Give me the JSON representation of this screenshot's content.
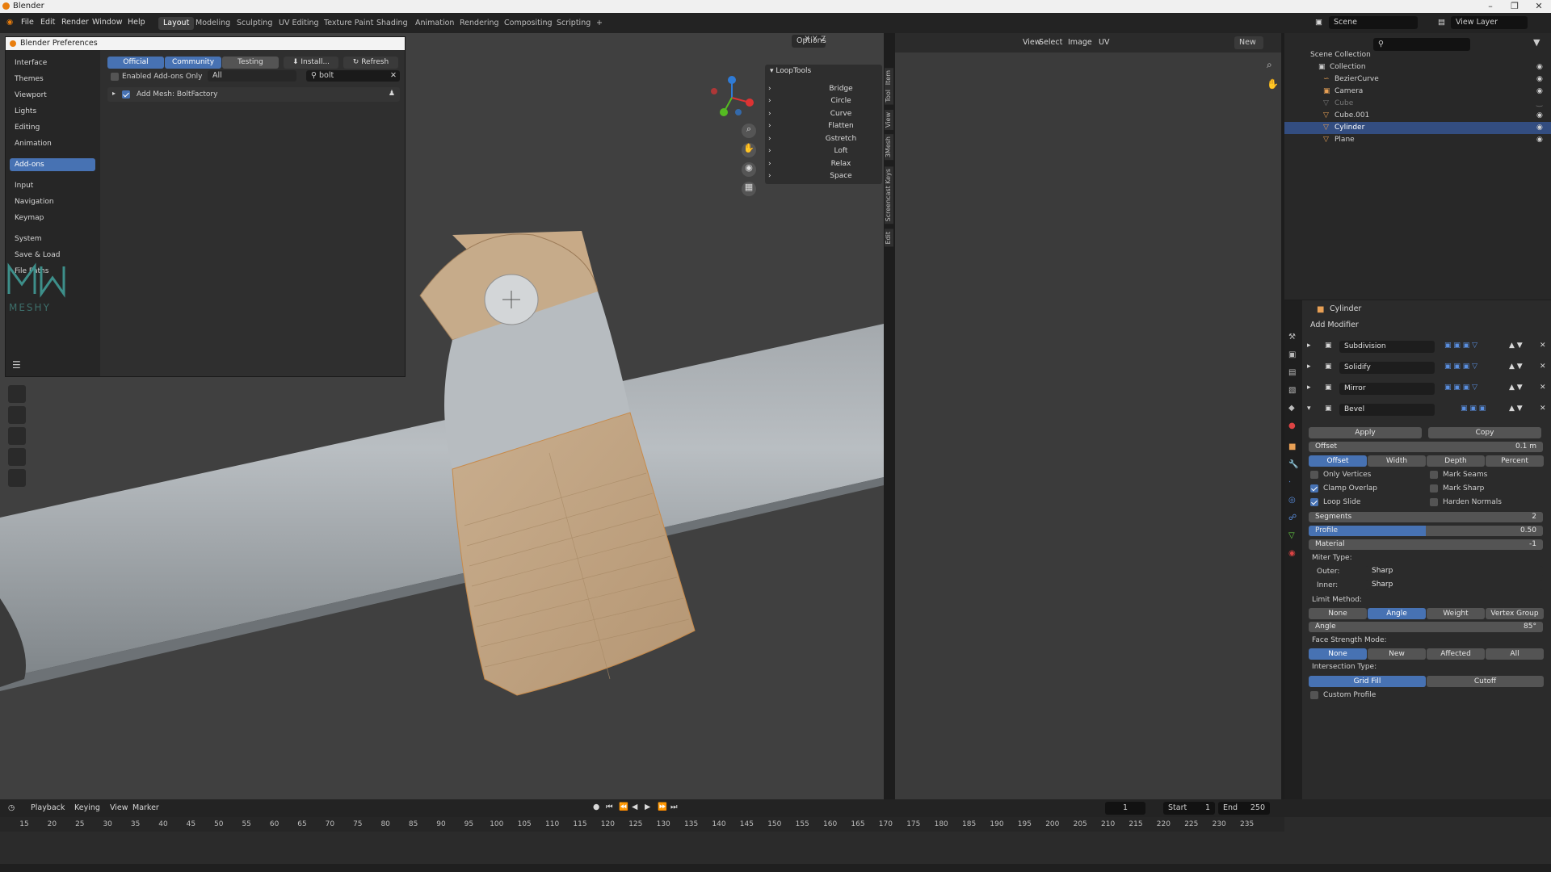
{
  "window": {
    "title": "Blender"
  },
  "menu": {
    "items": [
      "File",
      "Edit",
      "Render",
      "Window",
      "Help"
    ]
  },
  "workspaces": [
    "Layout",
    "Modeling",
    "Sculpting",
    "UV Editing",
    "Texture Paint",
    "Shading",
    "Animation",
    "Rendering",
    "Compositing",
    "Scripting"
  ],
  "workspace_add": "+",
  "scene": {
    "label": "Scene",
    "view_layer": "View Layer"
  },
  "viewport": {
    "options_label": "Options",
    "axes": [
      "X",
      "Y",
      "Z"
    ]
  },
  "image_editor": {
    "menu": [
      "View",
      "Select",
      "Image",
      "UV"
    ],
    "new_label": "New"
  },
  "preferences": {
    "title": "Blender Preferences",
    "sidebar": [
      "Interface",
      "Themes",
      "Viewport",
      "Lights",
      "Editing",
      "Animation",
      "Add-ons",
      "Input",
      "Navigation",
      "Keymap",
      "System",
      "Save & Load",
      "File Paths"
    ],
    "active": "Add-ons",
    "tabs": [
      "Official",
      "Community",
      "Testing"
    ],
    "install_label": "Install...",
    "refresh_label": "Refresh",
    "enabled_only_label": "Enabled Add-ons Only",
    "category": "All",
    "search_value": "bolt",
    "addon": "Add Mesh: BoltFactory",
    "watermark": "MESHY"
  },
  "looptools": {
    "title": "LoopTools",
    "items": [
      "Bridge",
      "Circle",
      "Curve",
      "Flatten",
      "Gstretch",
      "Loft",
      "Relax",
      "Space"
    ]
  },
  "side_tabs": [
    "Item",
    "Tool",
    "View",
    "3Mesh",
    "Screencast Keys",
    "Edit"
  ],
  "outliner": {
    "root": "Scene Collection",
    "collection": "Collection",
    "objects": [
      "BezierCurve",
      "Camera",
      "Cube",
      "Cube.001",
      "Cylinder",
      "Plane"
    ],
    "selected": "Cylinder"
  },
  "properties": {
    "object": "Cylinder",
    "add_modifier": "Add Modifier",
    "modifiers": [
      "Subdivision",
      "Solidify",
      "Mirror",
      "Bevel"
    ],
    "apply_label": "Apply",
    "copy_label": "Copy",
    "offset_label": "Offset",
    "offset_value": "0.1 m",
    "width_types": [
      "Offset",
      "Width",
      "Depth",
      "Percent"
    ],
    "only_vertices": "Only Vertices",
    "clamp_overlap": "Clamp Overlap",
    "loop_slide": "Loop Slide",
    "mark_seams": "Mark Seams",
    "mark_sharp": "Mark Sharp",
    "harden_normals": "Harden Normals",
    "segments_label": "Segments",
    "segments_value": "2",
    "profile_label": "Profile",
    "profile_value": "0.50",
    "profile_fraction": 0.5,
    "material_label": "Material",
    "material_value": "-1",
    "miter_type": "Miter Type:",
    "outer_label": "Outer:",
    "outer_value": "Sharp",
    "inner_label": "Inner:",
    "inner_value": "Sharp",
    "limit_method": "Limit Method:",
    "limit_options": [
      "None",
      "Angle",
      "Weight",
      "Vertex Group"
    ],
    "angle_label": "Angle",
    "angle_value": "85°",
    "face_strength": "Face Strength Mode:",
    "face_options": [
      "None",
      "New",
      "Affected",
      "All"
    ],
    "intersection": "Intersection Type:",
    "intersection_options": [
      "Grid Fill",
      "Cutoff"
    ],
    "custom_profile": "Custom Profile"
  },
  "timeline": {
    "menu": [
      "Playback",
      "Keying",
      "View",
      "Marker"
    ],
    "current_frame": "1",
    "start_label": "Start",
    "start_value": "1",
    "end_label": "End",
    "end_value": "250",
    "ticks": [
      "15",
      "20",
      "25",
      "30",
      "35",
      "40",
      "45",
      "50",
      "55",
      "60",
      "65",
      "70",
      "75",
      "80",
      "85",
      "90",
      "95",
      "100",
      "105",
      "110",
      "115",
      "120",
      "125",
      "130",
      "135",
      "140",
      "145",
      "150",
      "155",
      "160",
      "165",
      "170",
      "175",
      "180",
      "185",
      "190",
      "195",
      "200",
      "205",
      "210",
      "215",
      "220",
      "225",
      "230",
      "235"
    ]
  }
}
